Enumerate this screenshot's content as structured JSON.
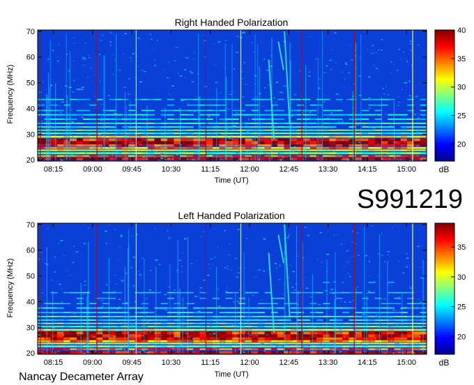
{
  "station_code": "S991219",
  "footer": "Nancay Decameter Array",
  "colors": {
    "background_blue": "#0a3fd8",
    "band_red": "#9a0000",
    "marker_red": "#c80000",
    "marker_yellow": "#ffff40",
    "marker_cyan": "#80ffff"
  },
  "chart_data": [
    {
      "type": "heatmap",
      "title": "Right Handed Polarization",
      "xlabel": "Time (UT)",
      "ylabel": "Frequency (MHz)",
      "colorbar_label": "dB",
      "x_ticks": [
        "08:15",
        "09:00",
        "09:45",
        "10:30",
        "11:15",
        "12:00",
        "12:45",
        "13:30",
        "14:15",
        "15:00"
      ],
      "y_ticks": [
        20,
        30,
        40,
        50,
        60,
        70
      ],
      "ylim": [
        19.5,
        70.5
      ],
      "colorbar_range": [
        17,
        40
      ],
      "colorbar_ticks": [
        20,
        25,
        30,
        35,
        40
      ]
    },
    {
      "type": "heatmap",
      "title": "Left Handed Polarization",
      "xlabel": "Time (UT)",
      "ylabel": "Frequency (MHz)",
      "colorbar_label": "dB",
      "x_ticks": [
        "08:15",
        "09:00",
        "09:45",
        "10:30",
        "11:15",
        "12:00",
        "12:45",
        "13:30",
        "14:15",
        "15:00"
      ],
      "y_ticks": [
        20,
        30,
        40,
        50,
        60,
        70
      ],
      "ylim": [
        19.5,
        70.5
      ],
      "colorbar_range": [
        17,
        39
      ],
      "colorbar_ticks": [
        20,
        25,
        30,
        35
      ]
    }
  ]
}
